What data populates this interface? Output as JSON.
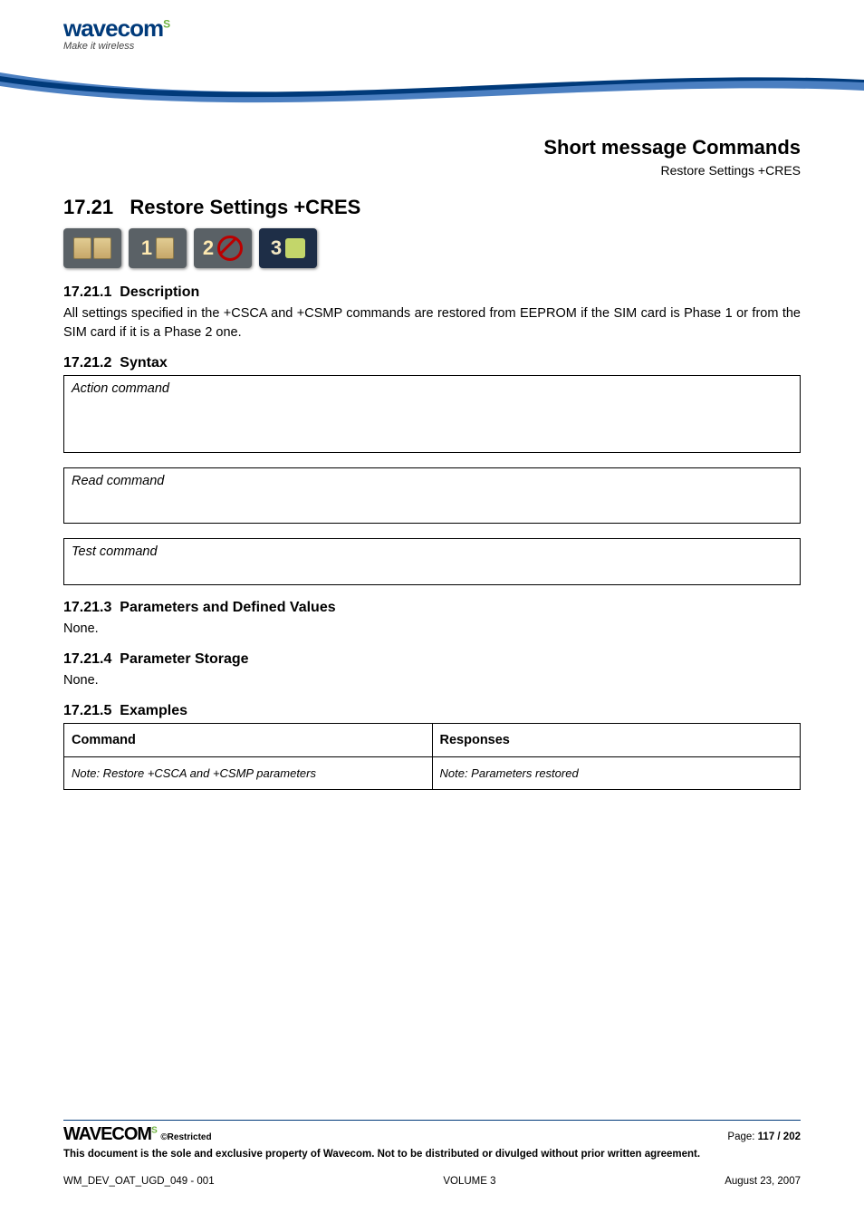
{
  "brand": {
    "name": "wavecom",
    "tagline": "Make it wireless"
  },
  "titles": {
    "section": "Short message Commands",
    "subsection": "Restore Settings +CRES",
    "heading_num": "17.21",
    "heading_text": "Restore Settings +CRES"
  },
  "sub": {
    "desc_num": "17.21.1",
    "desc_title": "Description",
    "desc_body": "All settings specified in the +CSCA and +CSMP commands are restored from EEPROM if the SIM card is Phase 1 or from the SIM card if it is a Phase 2 one.",
    "syntax_num": "17.21.2",
    "syntax_title": "Syntax",
    "action_label": "Action command",
    "read_label": "Read command",
    "test_label": "Test command",
    "params_num": "17.21.3",
    "params_title": "Parameters and Defined Values",
    "params_body": "None.",
    "storage_num": "17.21.4",
    "storage_title": "Parameter Storage",
    "storage_body": "None.",
    "examples_num": "17.21.5",
    "examples_title": "Examples"
  },
  "table": {
    "col1": "Command",
    "col2": "Responses",
    "row1c1": "Note: Restore +CSCA and +CSMP parameters",
    "row1c2": "Note: Parameters restored"
  },
  "footer": {
    "brand": "WAVECOM",
    "restricted": "©Restricted",
    "page_label": "Page: ",
    "page_num": "117 / 202",
    "legal": "This document is the sole and exclusive property of Wavecom. Not to be distributed or divulged without prior written agreement.",
    "docid": "WM_DEV_OAT_UGD_049 - 001",
    "volume": "VOLUME 3",
    "date": "August 23, 2007"
  }
}
